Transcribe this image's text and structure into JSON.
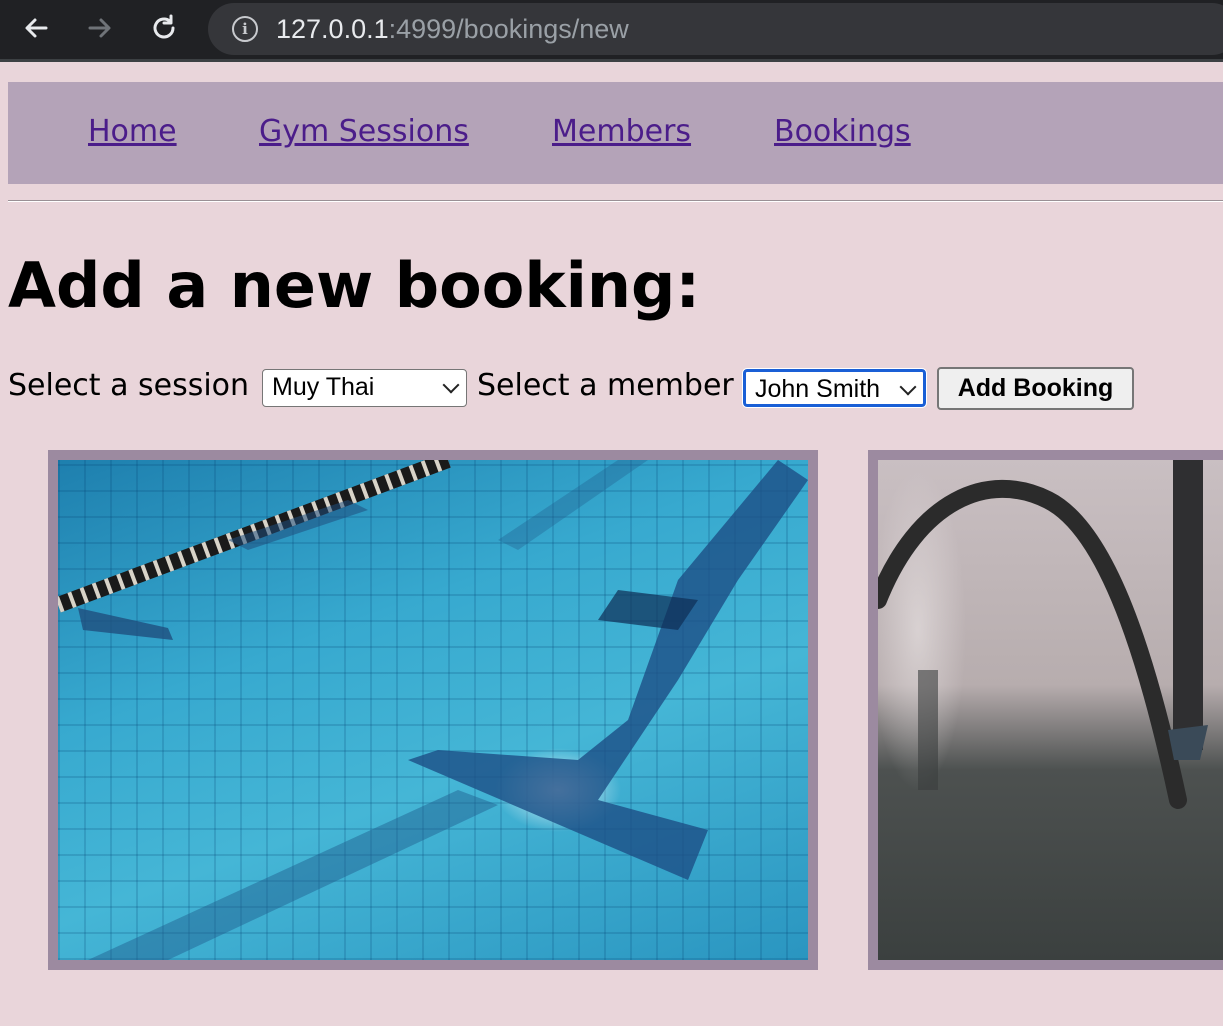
{
  "browser": {
    "back_icon": "arrow-left-icon",
    "forward_icon": "arrow-right-icon",
    "reload_icon": "reload-icon",
    "info_icon": "info-icon",
    "url_host": "127.0.0.1",
    "url_rest": ":4999/bookings/new"
  },
  "nav": {
    "items": [
      {
        "label": "Home"
      },
      {
        "label": "Gym Sessions"
      },
      {
        "label": "Members"
      },
      {
        "label": "Bookings"
      }
    ]
  },
  "page": {
    "title": "Add a new booking:"
  },
  "form": {
    "session_label": "Select a session",
    "session_value": "Muy Thai",
    "member_label": "Select a member",
    "member_value": "John Smith",
    "submit_label": "Add Booking"
  },
  "images": [
    {
      "subject": "swimming-pool-photo"
    },
    {
      "subject": "battle-ropes-gym-photo"
    }
  ],
  "colors": {
    "page_background": "#e9d5da",
    "nav_background": "#b4a3b8",
    "link": "#4b1d8a",
    "card_frame": "#9c8aa0",
    "focus_ring": "#1a5fd6"
  }
}
